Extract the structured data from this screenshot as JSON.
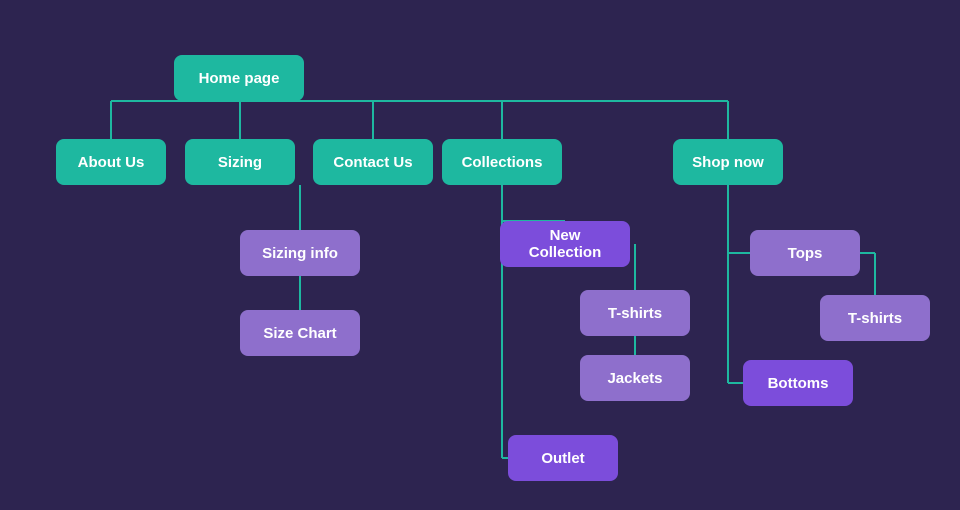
{
  "nodes": {
    "home_page": "Home page",
    "about_us": "About Us",
    "sizing": "Sizing",
    "contact_us": "Contact Us",
    "collections": "Collections",
    "shop_now": "Shop now",
    "sizing_info": "Sizing info",
    "size_chart": "Size Chart",
    "new_collection": "New Collection",
    "t_shirts_1": "T-shirts",
    "jackets": "Jackets",
    "outlet": "Outlet",
    "tops": "Tops",
    "t_shirts_2": "T-shirts",
    "bottoms": "Bottoms"
  },
  "colors": {
    "teal": "#1eb8a0",
    "purple": "#7c4ddb",
    "purple_light": "#8e6fcc",
    "line": "#1eb8a0",
    "bg": "#2d2450"
  }
}
